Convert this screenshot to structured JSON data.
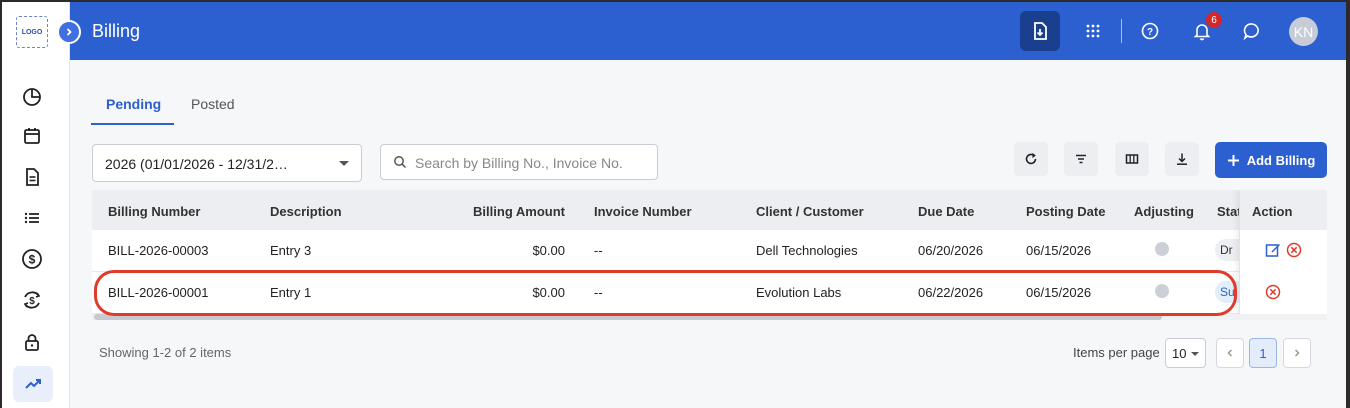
{
  "app": {
    "logo_text": "LOGO"
  },
  "header": {
    "title": "Billing",
    "notification_count": "6",
    "avatar_initials": "KN"
  },
  "sidebar": {
    "items": [
      {
        "icon": "pie-chart-icon"
      },
      {
        "icon": "calendar-icon"
      },
      {
        "icon": "document-icon"
      },
      {
        "icon": "list-icon"
      },
      {
        "icon": "dollar-circle-icon"
      },
      {
        "icon": "currency-exchange-icon"
      },
      {
        "icon": "lock-icon"
      },
      {
        "icon": "trending-up-icon",
        "active": true
      }
    ]
  },
  "tabs": [
    {
      "label": "Pending",
      "active": true
    },
    {
      "label": "Posted",
      "active": false
    }
  ],
  "filters": {
    "year_value": "2026 (01/01/2026 - 12/31/2…",
    "search_placeholder": "Search by Billing No., Invoice No.",
    "add_label": "Add Billing"
  },
  "table": {
    "columns": [
      "Billing Number",
      "Description",
      "Billing Amount",
      "Invoice Number",
      "Client / Customer",
      "Due Date",
      "Posting Date",
      "Adjusting",
      "Status",
      "Action"
    ],
    "status_header_visible": "Stat",
    "rows": [
      {
        "billing_number": "BILL-2026-00003",
        "description": "Entry 3",
        "amount": "$0.00",
        "invoice": "--",
        "client": "Dell Technologies",
        "due_date": "06/20/2026",
        "posting_date": "06/15/2026",
        "status_visible": "Dr",
        "actions": [
          "edit-icon",
          "cancel-icon"
        ]
      },
      {
        "billing_number": "BILL-2026-00001",
        "description": "Entry 1",
        "amount": "$0.00",
        "invoice": "--",
        "client": "Evolution Labs",
        "due_date": "06/22/2026",
        "posting_date": "06/15/2026",
        "status_visible": "Su",
        "actions": [
          "cancel-icon"
        ],
        "highlighted": true
      }
    ]
  },
  "footer": {
    "showing": "Showing 1-2 of 2 items",
    "items_per_page_label": "Items per page",
    "items_per_page": "10",
    "current_page": "1"
  },
  "colors": {
    "primary": "#2c5fcf",
    "highlight": "#e03a2a",
    "badge": "#d3272b"
  }
}
